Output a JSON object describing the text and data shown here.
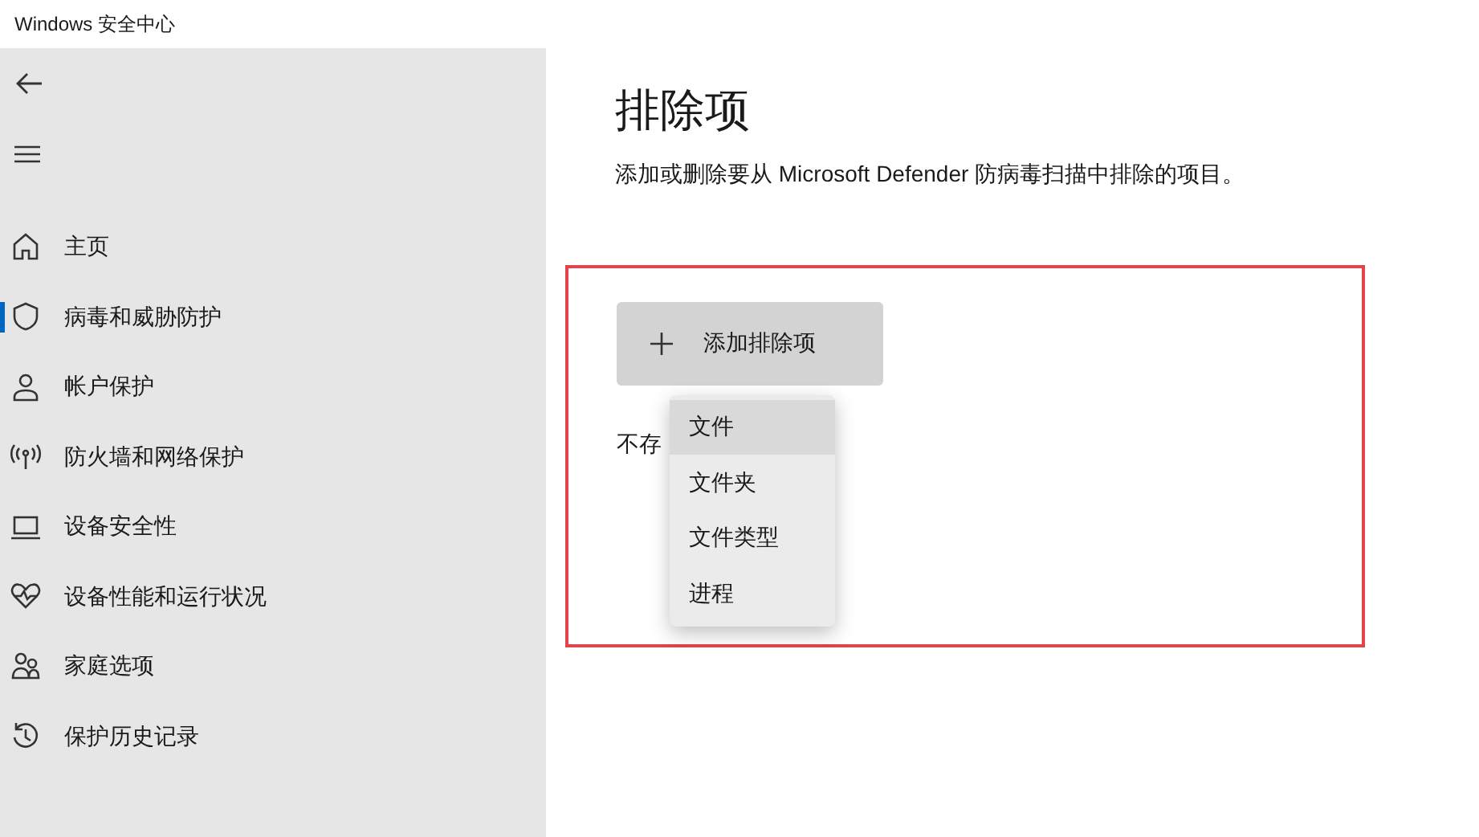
{
  "window": {
    "title": "Windows 安全中心"
  },
  "sidebar": {
    "items": [
      {
        "label": "主页",
        "selected": false
      },
      {
        "label": "病毒和威胁防护",
        "selected": true
      },
      {
        "label": "帐户保护",
        "selected": false
      },
      {
        "label": "防火墙和网络保护",
        "selected": false
      },
      {
        "label": "设备安全性",
        "selected": false
      },
      {
        "label": "设备性能和运行状况",
        "selected": false
      },
      {
        "label": "家庭选项",
        "selected": false
      },
      {
        "label": "保护历史记录",
        "selected": false
      }
    ]
  },
  "page": {
    "title": "排除项",
    "description": "添加或删除要从 Microsoft Defender 防病毒扫描中排除的项目。",
    "add_button": {
      "label": "添加排除项"
    },
    "empty_text": "不存",
    "menu": [
      {
        "label": "文件",
        "selected": true
      },
      {
        "label": "文件夹",
        "selected": false
      },
      {
        "label": "文件类型",
        "selected": false
      },
      {
        "label": "进程",
        "selected": false
      }
    ]
  }
}
